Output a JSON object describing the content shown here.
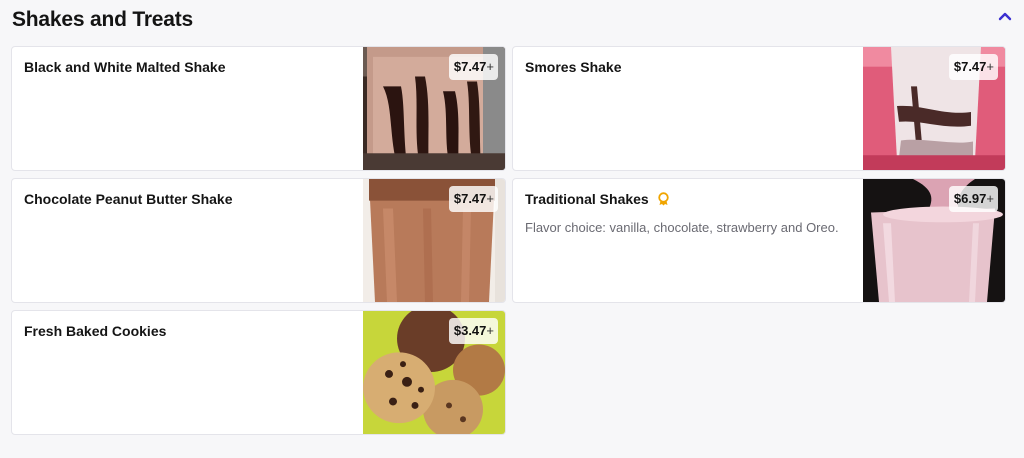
{
  "section": {
    "title": "Shakes and Treats",
    "collapse_icon": "chevron-up-icon",
    "accent": "#3b2fd1"
  },
  "items": [
    {
      "name": "Black and White Malted Shake",
      "description": "",
      "price": "$7.47",
      "price_suffix": "+",
      "badge": "",
      "image": "chocolate-drizzle-shake-photo"
    },
    {
      "name": "Smores Shake",
      "description": "",
      "price": "$7.47",
      "price_suffix": "+",
      "badge": "",
      "image": "smores-shake-photo"
    },
    {
      "name": "Chocolate Peanut Butter Shake",
      "description": "",
      "price": "$7.47",
      "price_suffix": "+",
      "badge": "",
      "image": "chocolate-peanut-butter-shake-photo"
    },
    {
      "name": "Traditional Shakes",
      "description": "Flavor choice: vanilla, chocolate, strawberry and Oreo.",
      "price": "$6.97",
      "price_suffix": "+",
      "badge": "award-ribbon-icon",
      "badge_color": "#f0a500",
      "image": "strawberry-shake-photo"
    },
    {
      "name": "Fresh Baked Cookies",
      "description": "",
      "price": "$3.47",
      "price_suffix": "+",
      "badge": "",
      "image": "chocolate-chip-cookies-photo"
    }
  ]
}
